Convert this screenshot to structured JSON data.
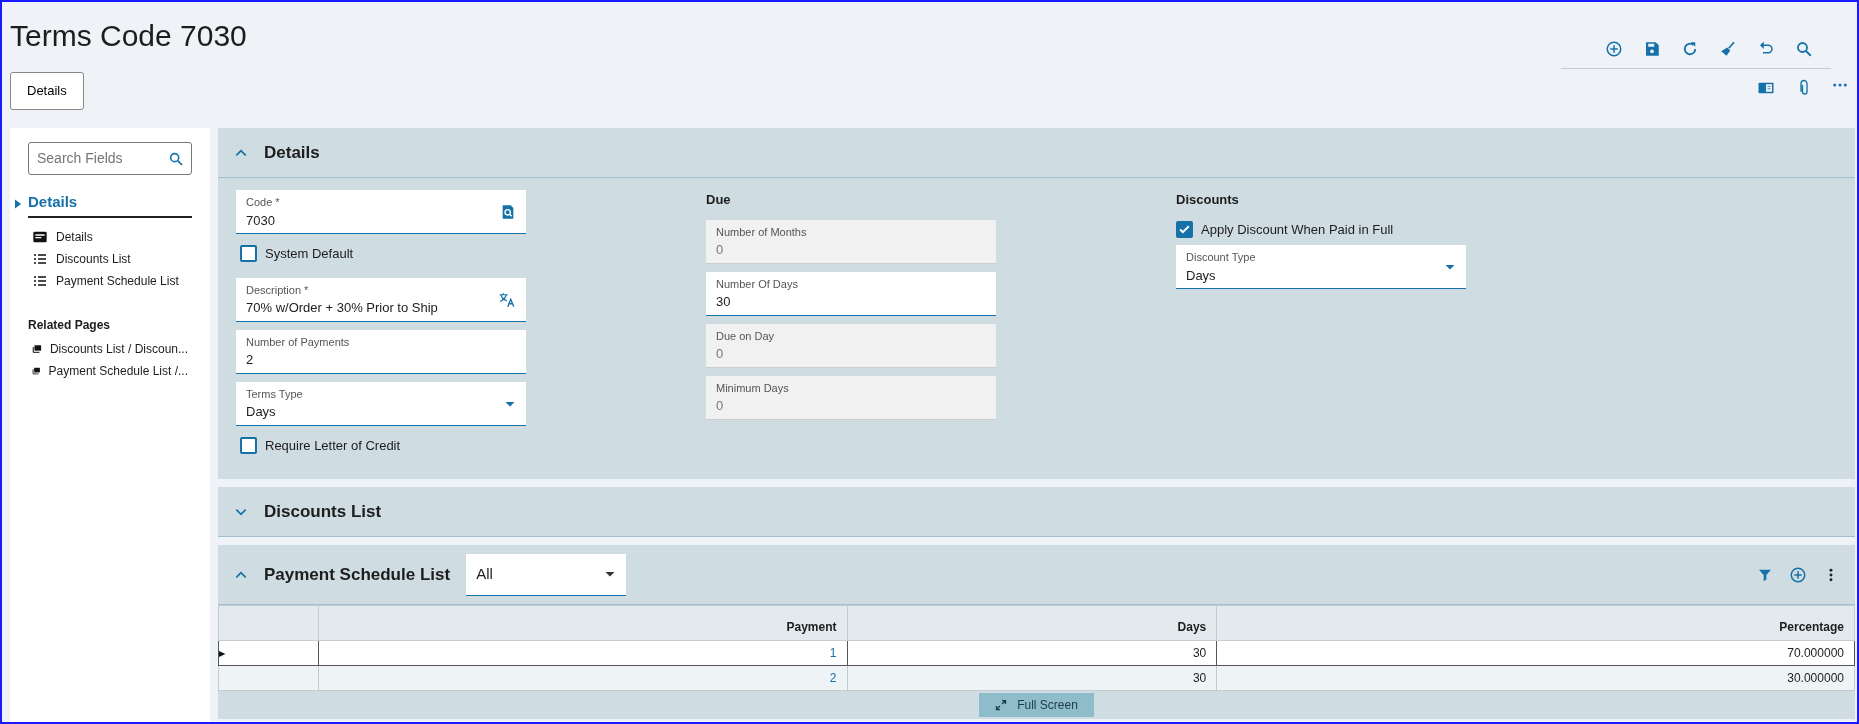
{
  "page": {
    "title": "Terms Code 7030",
    "tab_button": "Details"
  },
  "sidebar": {
    "search": {
      "placeholder": "Search Fields"
    },
    "section": {
      "label": "Details",
      "expanded": true
    },
    "items": [
      {
        "label": "Details",
        "kind": "form"
      },
      {
        "label": "Discounts List",
        "kind": "list"
      },
      {
        "label": "Payment Schedule List",
        "kind": "list"
      }
    ],
    "related_title": "Related Pages",
    "related": [
      "Discounts List / Discoun...",
      "Payment Schedule List /..."
    ]
  },
  "details": {
    "title": "Details",
    "expanded": true,
    "left": [
      {
        "kind": "field",
        "label": "Code *",
        "value": "7030"
      },
      {
        "kind": "check",
        "label": "System Default",
        "checked": false
      },
      {
        "kind": "field",
        "label": "Description *",
        "value": "70% w/Order + 30% Prior to Ship"
      },
      {
        "kind": "field",
        "label": "Number of Payments",
        "value": "2"
      },
      {
        "kind": "select",
        "label": "Terms Type",
        "value": "Days"
      },
      {
        "kind": "check",
        "label": "Require Letter of Credit",
        "checked": false
      }
    ],
    "due": {
      "title": "Due",
      "fields": [
        {
          "label": "Number of Months",
          "value": "0",
          "disabled": true
        },
        {
          "label": "Number Of Days",
          "value": "30",
          "disabled": false
        },
        {
          "label": "Due on Day",
          "value": "0",
          "disabled": true
        },
        {
          "label": "Minimum Days",
          "value": "0",
          "disabled": true
        }
      ]
    },
    "discounts": {
      "title": "Discounts",
      "fields": [
        {
          "kind": "check",
          "label": "Apply Discount When Paid in Full",
          "checked": true
        },
        {
          "kind": "select",
          "label": "Discount Type",
          "value": "Days"
        }
      ]
    }
  },
  "discounts_list": {
    "title": "Discounts List",
    "expanded": false
  },
  "payment_schedule": {
    "title": "Payment Schedule List",
    "expanded": true,
    "filter": "All",
    "columns": [
      "Payment",
      "Days",
      "Percentage"
    ],
    "rows": [
      {
        "cells": [
          "1",
          "30",
          "70.000000"
        ],
        "selected": true
      },
      {
        "cells": [
          "2",
          "30",
          "30.000000"
        ],
        "selected": false
      }
    ],
    "full_screen": "Full Screen"
  }
}
